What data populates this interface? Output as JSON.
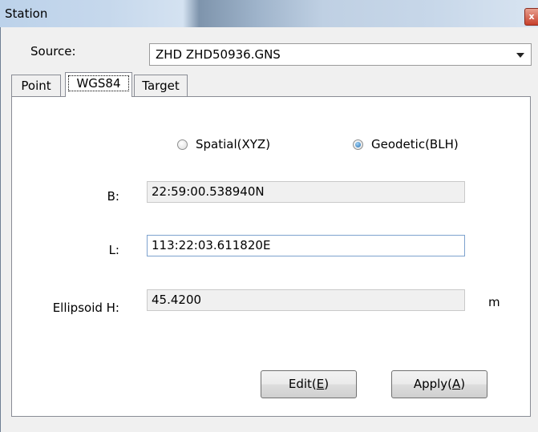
{
  "window": {
    "title": "Station",
    "close_glyph": "x"
  },
  "source": {
    "label": "Source:",
    "value": "ZHD ZHD50936.GNS"
  },
  "tabs": [
    {
      "label": "Point",
      "active": false
    },
    {
      "label": "WGS84",
      "active": true
    },
    {
      "label": "Target",
      "active": false
    }
  ],
  "coord_mode": {
    "spatial_label": "Spatial(XYZ)",
    "geodetic_label": "Geodetic(BLH)",
    "selected": "Geodetic(BLH)"
  },
  "fields": {
    "b": {
      "label": "B:",
      "value": "22:59:00.538940N"
    },
    "l": {
      "label": "L:",
      "value": "113:22:03.611820E"
    },
    "h": {
      "label": "Ellipsoid H:",
      "value": "45.4200",
      "unit": "m"
    }
  },
  "buttons": {
    "edit": {
      "text": "Edit(",
      "mnemonic": "E",
      "close": ")"
    },
    "apply": {
      "text": "Apply(",
      "mnemonic": "A",
      "close": ")"
    }
  },
  "colors": {
    "accent": "#1f6fb4",
    "focus_border": "#7da2ce"
  }
}
